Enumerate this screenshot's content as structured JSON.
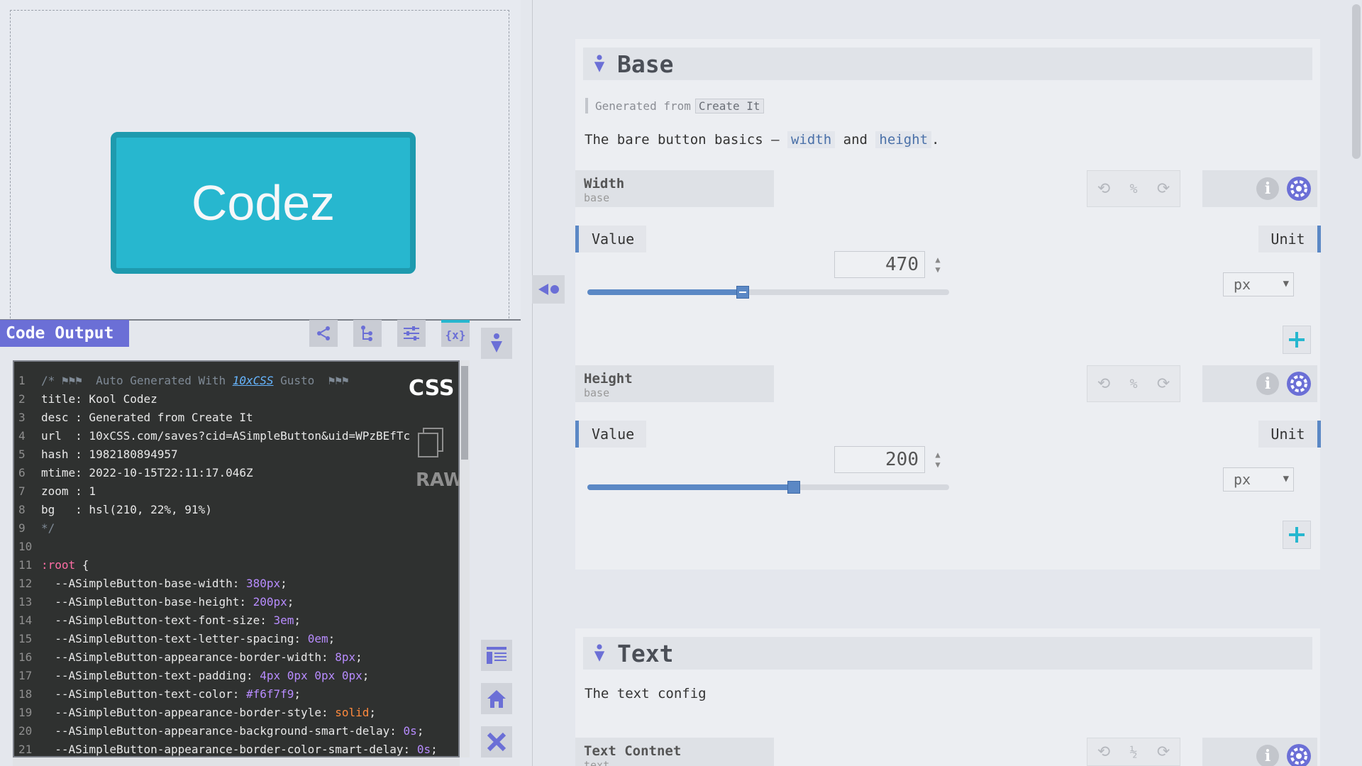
{
  "preview": {
    "button_label": "Codez"
  },
  "output": {
    "title": "Code Output",
    "css_label": "CSS",
    "raw_label": "RAW",
    "header_comment": "/* ⚑⚑⚑  Auto Generated With ",
    "header_link": "10xCSS",
    "header_tail": " Gusto  ⚑⚑⚑",
    "lines": [
      "title: Kool Codez",
      "desc : Generated from Create It",
      "url  : 10xCSS.com/saves?cid=ASimpleButton&uid=WPzBEfTc",
      "hash : 1982180894957",
      "mtime: 2022-10-15T22:11:17.046Z",
      "zoom : 1",
      "bg   : hsl(210, 22%, 91%)",
      "*/",
      "",
      ":root {"
    ],
    "vars": [
      [
        "--ASimpleButton-base-width",
        "380px",
        "num"
      ],
      [
        "--ASimpleButton-base-height",
        "200px",
        "num"
      ],
      [
        "--ASimpleButton-text-font-size",
        "3em",
        "num"
      ],
      [
        "--ASimpleButton-text-letter-spacing",
        "0em",
        "num"
      ],
      [
        "--ASimpleButton-appearance-border-width",
        "8px",
        "num"
      ],
      [
        "--ASimpleButton-text-padding",
        "4px 0px 0px 0px",
        "num"
      ],
      [
        "--ASimpleButton-text-color",
        "#f6f7f9",
        "num"
      ],
      [
        "--ASimpleButton-appearance-border-style",
        "solid",
        "str"
      ],
      [
        "--ASimpleButton-appearance-background-smart-delay",
        "0s",
        "num"
      ],
      [
        "--ASimpleButton-appearance-border-color-smart-delay",
        "0s",
        "num"
      ]
    ]
  },
  "base": {
    "title": "Base",
    "generated_prefix": "Generated from",
    "generated_tag": "Create It",
    "desc_prefix": "The bare button basics — ",
    "desc_w1": "width",
    "desc_mid": " and ",
    "desc_w2": "height",
    "desc_end": ".",
    "width": {
      "name": "Width",
      "sub": "base",
      "value_label": "Value",
      "unit_label": "Unit",
      "value": "470",
      "unit": "px",
      "slider_fraction": 0.43,
      "ratio": "⁰⁄₀"
    },
    "height": {
      "name": "Height",
      "sub": "base",
      "value_label": "Value",
      "unit_label": "Unit",
      "value": "200",
      "unit": "px",
      "slider_fraction": 0.57
    }
  },
  "text": {
    "title": "Text",
    "desc": "The text config",
    "prop_name": "Text Contnet",
    "prop_sub": "text"
  },
  "colors": {
    "accent": "#6b6fd6",
    "slider": "#5b88c5",
    "button_bg": "#27b7cf"
  }
}
